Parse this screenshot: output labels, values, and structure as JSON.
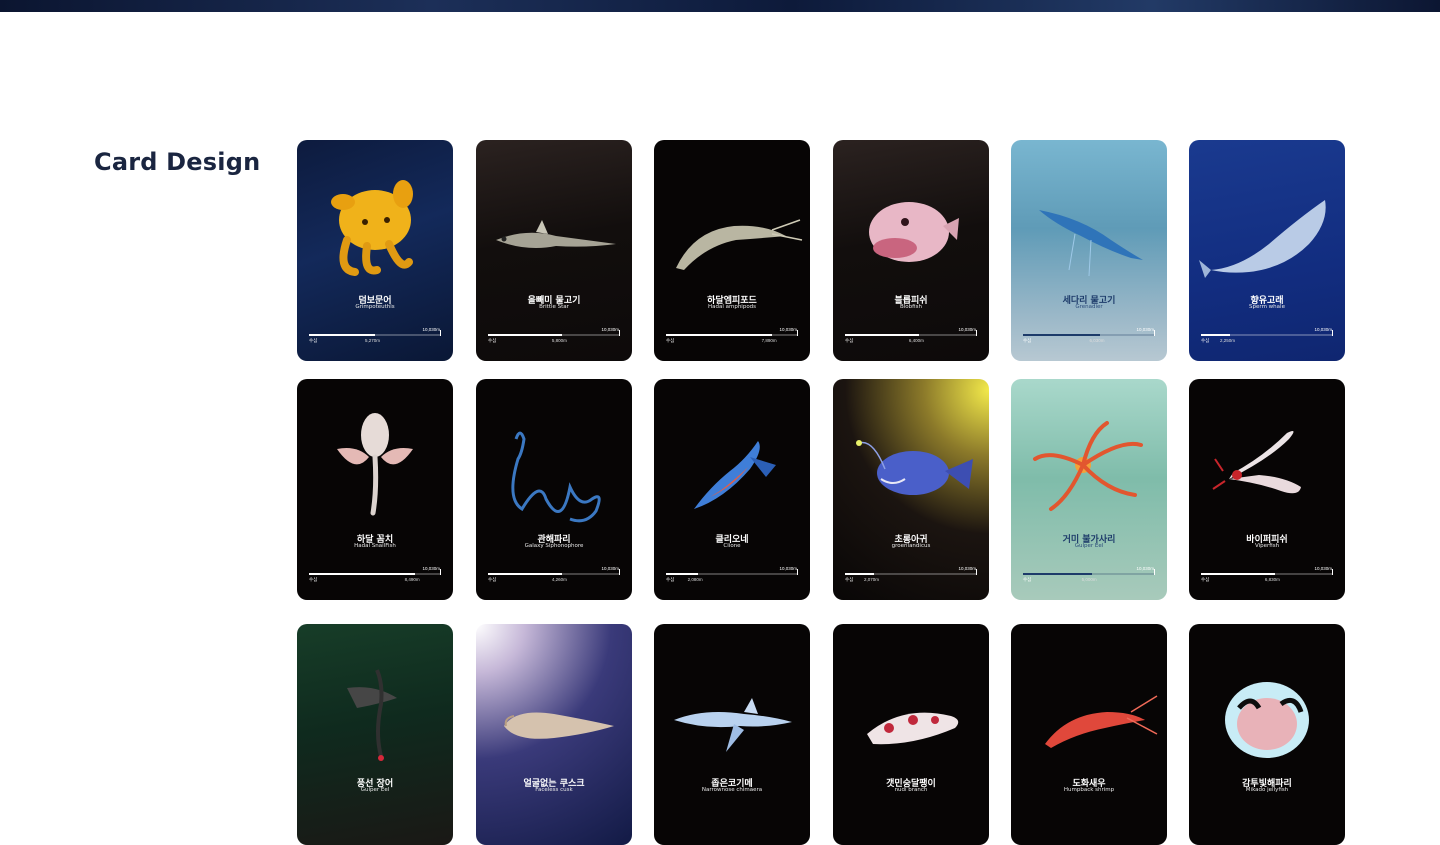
{
  "section_title": "Card Design",
  "cards": [
    {
      "ko": "덤보문어",
      "en": "Grimpoteuthis",
      "max": "10,030m",
      "left": "수심",
      "val": "5,270m",
      "fill": 0.5,
      "bg": "navy",
      "creature": "octopus"
    },
    {
      "ko": "올빼미 물고기",
      "en": "Brittle Star",
      "max": "10,030m",
      "left": "수심",
      "val": "5,800m",
      "fill": 0.56,
      "bg": "brown",
      "creature": "grenadier"
    },
    {
      "ko": "하달엠피포드",
      "en": "Hadal amphipods",
      "max": "10,030m",
      "left": "수심",
      "val": "7,890m",
      "fill": 0.8,
      "bg": "black",
      "creature": "shrimp-grey"
    },
    {
      "ko": "블롭피쉬",
      "en": "Blobfish",
      "max": "10,030m",
      "left": "수심",
      "val": "6,400m",
      "fill": 0.56,
      "bg": "brown",
      "creature": "blobfish"
    },
    {
      "ko": "세다리 물고기",
      "en": "Grenadier",
      "max": "10,030m",
      "left": "수심",
      "val": "6,030m",
      "fill": 0.58,
      "bg": "sea",
      "creature": "tripod"
    },
    {
      "ko": "향유고래",
      "en": "Sperm whale",
      "max": "10,030m",
      "left": "수심",
      "val": "2,250m",
      "fill": 0.22,
      "bg": "blue",
      "creature": "whale"
    },
    {
      "ko": "하달 꼼치",
      "en": "Hadal SnailFish",
      "max": "10,030m",
      "left": "수심",
      "val": "8,490m",
      "fill": 0.8,
      "bg": "black",
      "creature": "snailfish"
    },
    {
      "ko": "관해파리",
      "en": "Galaxy Siphonophore",
      "max": "10,030m",
      "left": "수심",
      "val": "4,260m",
      "fill": 0.56,
      "bg": "black",
      "creature": "siphonophore"
    },
    {
      "ko": "클리오네",
      "en": "Clione",
      "max": "10,030m",
      "left": "수심",
      "val": "2,080m",
      "fill": 0.24,
      "bg": "black",
      "creature": "clione"
    },
    {
      "ko": "초롱아귀",
      "en": "groenlandicus",
      "max": "10,030m",
      "left": "수심",
      "val": "2,070m",
      "fill": 0.22,
      "bg": "yellowglow",
      "creature": "anglerfish"
    },
    {
      "ko": "거미 불가사리",
      "en": "Gulper Eel",
      "max": "10,030m",
      "left": "수심",
      "val": "5,000m",
      "fill": 0.52,
      "bg": "seagreen",
      "creature": "starfish"
    },
    {
      "ko": "바이퍼피쉬",
      "en": "Viperfish",
      "max": "10,030m",
      "left": "수심",
      "val": "6,830m",
      "fill": 0.56,
      "bg": "black",
      "creature": "oarfish"
    },
    {
      "ko": "풍선 장어",
      "en": "Gulper Eel",
      "bg": "green",
      "creature": "gulper"
    },
    {
      "ko": "얼굴없는 쿠스크",
      "en": "Faceless cusk",
      "bg": "purpleglow",
      "creature": "cusk"
    },
    {
      "ko": "좁은코기메",
      "en": "Narrownose chimaera",
      "bg": "black",
      "creature": "chimaera"
    },
    {
      "ko": "갯민숭달팽이",
      "en": "nudi branch",
      "bg": "black",
      "creature": "nudibranch"
    },
    {
      "ko": "도화새우",
      "en": "Humpback shrimp",
      "bg": "black",
      "creature": "redshrimp"
    },
    {
      "ko": "감투빛해파리",
      "en": "Mikado jellyfish",
      "bg": "black",
      "creature": "jelly"
    }
  ]
}
